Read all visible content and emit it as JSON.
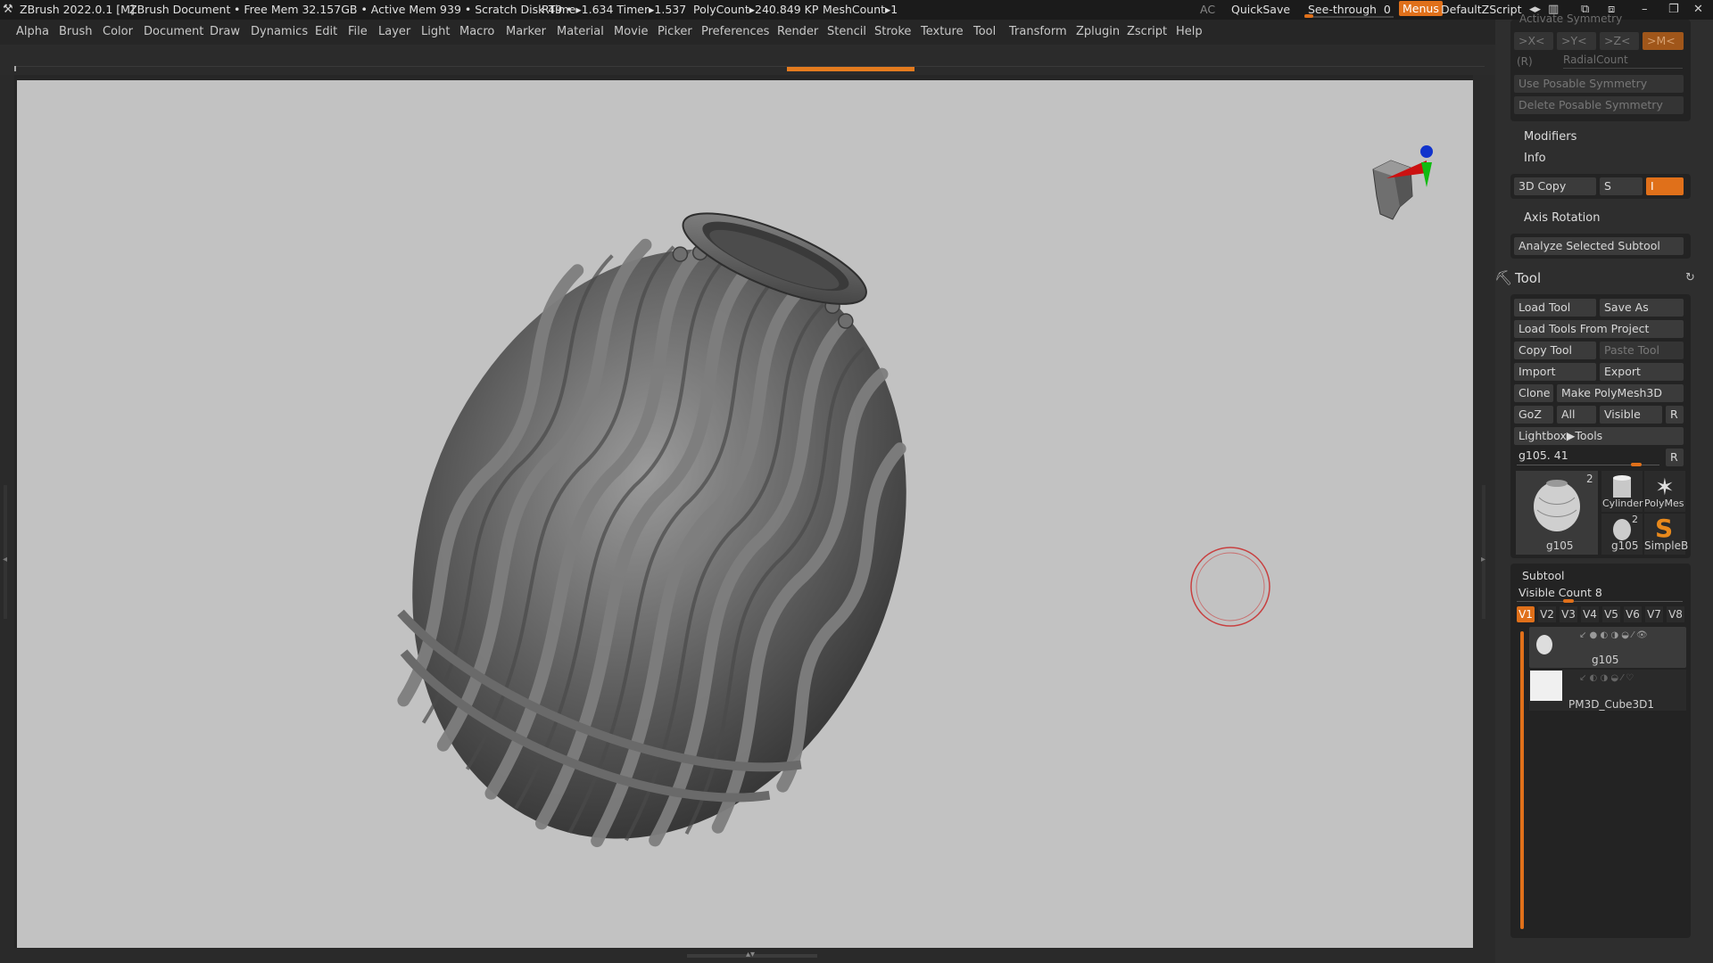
{
  "titlebar": {
    "app_title": "ZBrush 2022.0.1 [M]",
    "document": "ZBrush Document",
    "status": "• Free Mem 32.157GB • Active Mem 939 • Scratch Disk 49 •",
    "timing": "RTime▸1.634 Timer▸1.537",
    "polycount": "PolyCount▸240.849 KP",
    "meshcount": "MeshCount▸1",
    "ac": "AC",
    "quicksave": "QuickSave",
    "see_through_label": "See-through",
    "see_through_value": "0",
    "menus": "Menus",
    "default_zscript": "DefaultZScript"
  },
  "menus": [
    "Alpha",
    "Brush",
    "Color",
    "Document",
    "Draw",
    "Dynamics",
    "Edit",
    "File",
    "Layer",
    "Light",
    "Macro",
    "Marker",
    "Material",
    "Movie",
    "Picker",
    "Preferences",
    "Render",
    "Stencil",
    "Stroke",
    "Texture",
    "Tool",
    "Transform",
    "Zplugin",
    "Zscript",
    "Help"
  ],
  "right_panel": {
    "activate_symmetry": "Activate Symmetry",
    "sym_x": ">X<",
    "sym_y": ">Y<",
    "sym_z": ">Z<",
    "sym_m": ">M<",
    "sym_r": "(R)",
    "radial_count": "RadialCount",
    "use_posable": "Use Posable Symmetry",
    "delete_posable": "Delete Posable Symmetry",
    "modifiers": "Modifiers",
    "info": "Info",
    "copy3d": "3D Copy",
    "s": "S",
    "i": "I",
    "axis_rotation": "Axis Rotation",
    "analyze": "Analyze Selected Subtool",
    "tool_title": "Tool",
    "load_tool": "Load Tool",
    "save_as": "Save As",
    "load_from_project": "Load Tools From Project",
    "copy_tool": "Copy Tool",
    "paste_tool": "Paste Tool",
    "import": "Import",
    "export": "Export",
    "clone": "Clone",
    "make_polymesh": "Make PolyMesh3D",
    "goz": "GoZ",
    "all": "All",
    "visible": "Visible",
    "r": "R",
    "lightbox_tools": "Lightbox▶Tools",
    "current_tool": "g105. 41",
    "thumbs": {
      "main_name": "g105",
      "main_count": "2",
      "cylinder": "Cylinder",
      "polymesh": "PolyMes",
      "small_g105": "g105",
      "small_count": "2",
      "simpleb": "SimpleB"
    },
    "subtool_title": "Subtool",
    "visible_count_label": "Visible Count",
    "visible_count_value": "8",
    "vtabs": [
      "V1",
      "V2",
      "V3",
      "V4",
      "V5",
      "V6",
      "V7",
      "V8"
    ],
    "subtools": [
      "g105",
      "PM3D_Cube3D1"
    ]
  },
  "colors": {
    "accent": "#e0701a",
    "viewport_bg": "#c2c2c2",
    "panel_bg": "#2e2e2e"
  }
}
